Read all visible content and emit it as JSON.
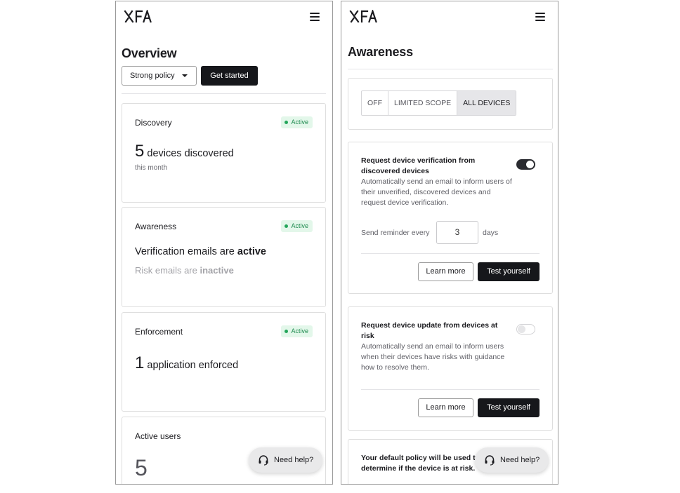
{
  "left": {
    "logo": "XFA",
    "title": "Overview",
    "policy_select": "Strong policy",
    "get_started": "Get started",
    "cards": {
      "discovery": {
        "title": "Discovery",
        "badge": "Active",
        "number": "5",
        "text": "devices discovered",
        "sub": "this month"
      },
      "awareness": {
        "title": "Awareness",
        "badge": "Active",
        "verification_prefix": "Verification emails are ",
        "verification_status": "active",
        "risk_prefix": "Risk emails are ",
        "risk_status": "inactive"
      },
      "enforcement": {
        "title": "Enforcement",
        "badge": "Active",
        "number": "1",
        "text": "application enforced"
      },
      "active_users": {
        "title": "Active users",
        "number": "5"
      }
    },
    "help": "Need help?"
  },
  "right": {
    "logo": "XFA",
    "title": "Awareness",
    "scope": {
      "options": [
        "OFF",
        "LIMITED SCOPE",
        "ALL DEVICES"
      ],
      "selected": "ALL DEVICES"
    },
    "verification": {
      "title": "Request device verification from discovered devices",
      "description": "Automatically send an email to inform users of their unverified, discovered devices and request device verification.",
      "enabled": true,
      "reminder_label": "Send reminder every",
      "reminder_value": "3",
      "reminder_unit": "days",
      "learn_more": "Learn more",
      "test": "Test yourself"
    },
    "risk": {
      "title": "Request device update from devices at risk",
      "description": "Automatically send an email to inform users when their devices have risks with guidance how to resolve them.",
      "enabled": false,
      "learn_more": "Learn more",
      "test": "Test yourself"
    },
    "policy_note": "Your default policy will be used to determine if the device is at risk.",
    "help": "Need help?"
  },
  "colors": {
    "accent_dark": "#16171b",
    "badge_bg": "#e3f7ea",
    "badge_text": "#1d8a4e"
  },
  "icons": [
    "xfa-logo",
    "hamburger-menu-icon",
    "caret-down-icon",
    "headset-icon"
  ]
}
